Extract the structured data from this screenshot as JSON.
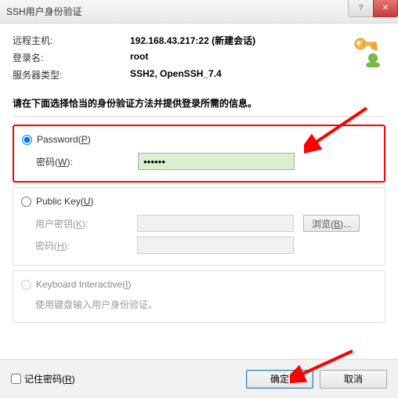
{
  "window": {
    "title": "SSH用户身份验证",
    "help_glyph": "?",
    "close_glyph": "✕"
  },
  "info": {
    "remote_host_label": "远程主机:",
    "remote_host_value": "192.168.43.217:22 (新建会话)",
    "login_label": "登录名:",
    "login_value": "root",
    "server_type_label": "服务器类型:",
    "server_type_value": "SSH2, OpenSSH_7.4"
  },
  "instruction": "请在下面选择恰当的身份验证方法并提供登录所需的信息。",
  "password_group": {
    "radio_label_prefix": "Password(",
    "radio_mnemonic": "P",
    "radio_label_suffix": ")",
    "field_label_prefix": "密码(",
    "field_mnemonic": "W",
    "field_label_suffix": "):",
    "value": "••••••"
  },
  "publickey_group": {
    "radio_label_prefix": "Public Key(",
    "radio_mnemonic": "U",
    "radio_label_suffix": ")",
    "userkey_label_prefix": "用户密钥(",
    "userkey_mnemonic": "K",
    "userkey_label_suffix": "):",
    "browse_prefix": "浏览(",
    "browse_mnemonic": "B",
    "browse_suffix": ")...",
    "passphrase_label_prefix": "密码(",
    "passphrase_mnemonic": "H",
    "passphrase_label_suffix": "):"
  },
  "keyboard_group": {
    "radio_label_prefix": "Keyboard Interactive(",
    "radio_mnemonic": "I",
    "radio_label_suffix": ")",
    "hint": "使用键盘输入用户身份验证。"
  },
  "footer": {
    "remember_prefix": "记住密码(",
    "remember_mnemonic": "R",
    "remember_suffix": ")",
    "ok": "确定",
    "cancel": "取消"
  }
}
